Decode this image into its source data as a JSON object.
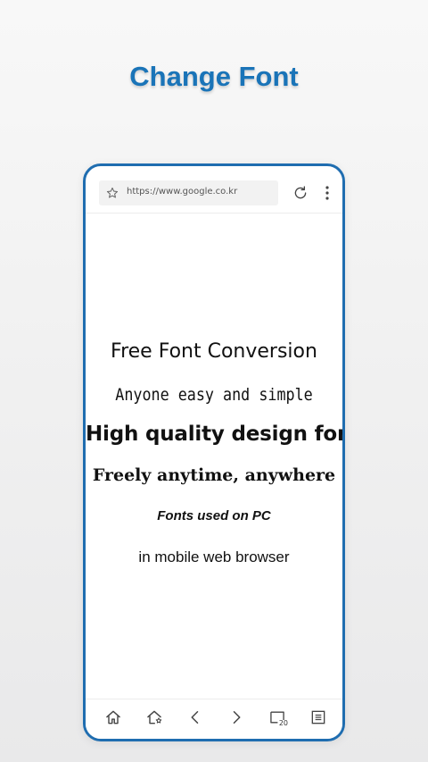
{
  "headline": "Change Font",
  "browser": {
    "url": "https://www.google.co.kr",
    "tab_count": "20"
  },
  "content": {
    "lines": [
      "Free Font Conversion",
      "Anyone easy and simple",
      "High quality design font",
      "Freely anytime, anywhere",
      "Fonts used on PC",
      "in mobile web browser"
    ]
  },
  "icons": {
    "favorite": "star-icon",
    "reload": "reload-icon",
    "menu": "kebab-menu-icon",
    "home": "home-icon",
    "bookmarks": "bookmark-home-icon",
    "back": "chevron-left-icon",
    "forward": "chevron-right-icon",
    "tabs": "tabs-icon",
    "list": "list-menu-icon"
  },
  "colors": {
    "accent": "#1a74b8",
    "frame": "#1f6db0"
  }
}
